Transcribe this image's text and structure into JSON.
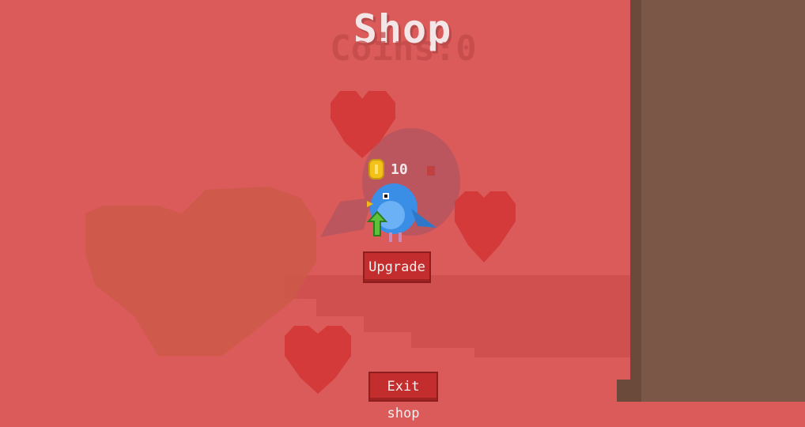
{
  "shop": {
    "title": "Shop",
    "coins_label": "Coins:0"
  },
  "item": {
    "price": "10",
    "upgrade_label": "Upgrade",
    "icons": [
      "coin-icon",
      "bird-icon",
      "upgrade-arrow-icon"
    ]
  },
  "footer": {
    "exit_label": "Exit shop"
  },
  "colors": {
    "background": "#db5a5a",
    "button": "#c42d2d",
    "pillar": "#7a5747",
    "coin": "#f2c21a",
    "bird": "#3a8ee6"
  }
}
